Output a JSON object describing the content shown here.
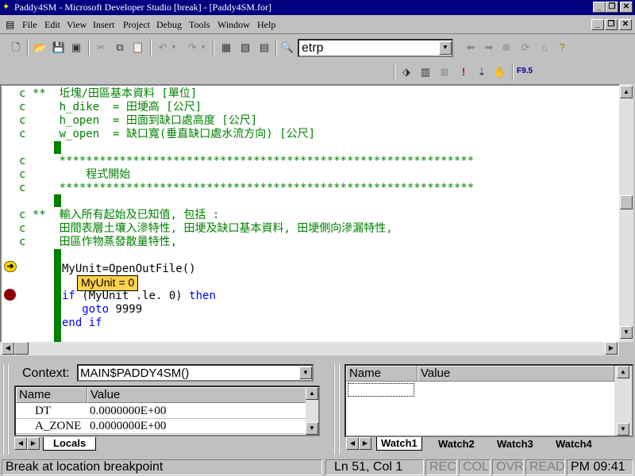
{
  "window": {
    "title": "Paddy4SM - Microsoft Developer Studio [break] - [Paddy4SM.for]"
  },
  "menu": [
    "File",
    "Edit",
    "View",
    "Insert",
    "Project",
    "Debug",
    "Tools",
    "Window",
    "Help"
  ],
  "toolbar": {
    "find_value": "etrp",
    "f90_label": "F9.5"
  },
  "editor": {
    "lines": [
      {
        "prefix": "c **",
        "text": "  坵塊/田區基本資料 [單位]"
      },
      {
        "prefix": "c",
        "text": "     h_dike  = 田埂高 [公尺]"
      },
      {
        "prefix": "c",
        "text": "     h_open  = 田面到缺口處高度 [公尺]"
      },
      {
        "prefix": "c",
        "text": "     w_open  = 缺口寬(垂直缺口處水流方向) [公尺]"
      },
      {
        "prefix": "c",
        "text": "     **************************************************************"
      },
      {
        "prefix": "c",
        "text": "         程式開始"
      },
      {
        "prefix": "c",
        "text": "     **************************************************************"
      },
      {
        "prefix": "c **",
        "text": "  輸入所有起始及已知值, 包括 :"
      },
      {
        "prefix": "c",
        "text": "     田間表層土壤入滲特性, 田埂及缺口基本資料, 田埂側向滲漏特性,"
      },
      {
        "prefix": "c",
        "text": "     田區作物蒸發散量特性,"
      }
    ],
    "code": {
      "line1": "MyUnit=OpenOutFile()",
      "if_kw": "if",
      "if_cond": " (MyUnit .le. 0) ",
      "then_kw": "then",
      "goto_kw": "goto",
      "goto_target": " 9999",
      "endif_kw": "end if"
    },
    "tooltip": "MyUnit = 0"
  },
  "variables": {
    "context_label": "Context:",
    "context_value": "MAIN$PADDY4SM()",
    "col_name": "Name",
    "col_value": "Value",
    "rows": [
      {
        "name": "DT",
        "value": "0.0000000E+00"
      },
      {
        "name": "A_ZONE",
        "value": "0.0000000E+00"
      }
    ],
    "tab": "Locals"
  },
  "watch": {
    "col_name": "Name",
    "col_value": "Value",
    "tabs": [
      "Watch1",
      "Watch2",
      "Watch3",
      "Watch4"
    ]
  },
  "status": {
    "message": "Break at location breakpoint",
    "position": "Ln 51, Col 1",
    "rec": "REC",
    "col": "COL",
    "ovr": "OVR",
    "read": "READ",
    "time": "PM 09:41"
  }
}
